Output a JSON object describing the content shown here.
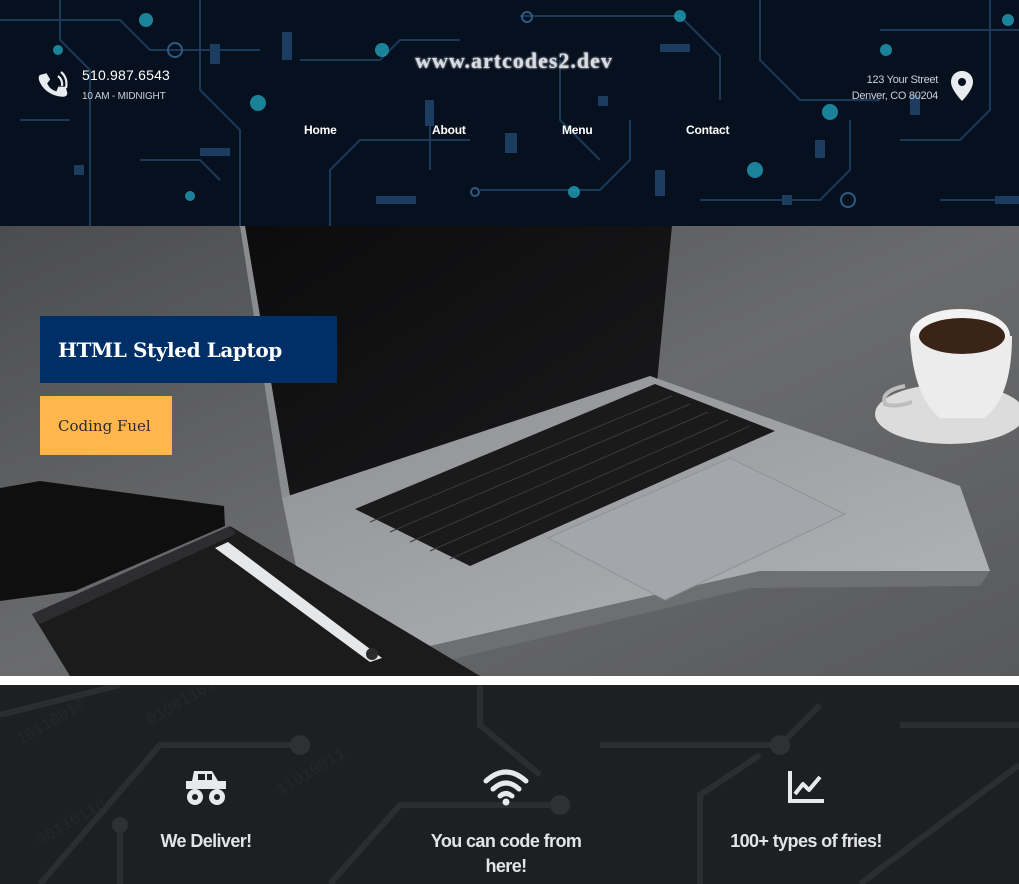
{
  "header": {
    "phone_number": "510.987.6543",
    "hours": "10 AM - MIDNIGHT",
    "logo_text": "www.artcodes2.dev",
    "address_line1": "123 Your Street",
    "address_line2": "Denver, CO 80204",
    "icons": {
      "phone": "phone-volume-icon",
      "location": "map-marker-icon"
    }
  },
  "nav": {
    "items": [
      {
        "label": "Home"
      },
      {
        "label": "About"
      },
      {
        "label": "Menu"
      },
      {
        "label": "Contact"
      }
    ]
  },
  "hero": {
    "title": "HTML Styled Laptop",
    "button_label": "Coding Fuel",
    "colors": {
      "title_bg": "#002e66",
      "button_bg": "#ffb74d"
    }
  },
  "features": {
    "items": [
      {
        "icon": "monster-truck-icon",
        "label": "We Deliver!"
      },
      {
        "icon": "wifi-icon",
        "label": "You can code from here!"
      },
      {
        "icon": "line-chart-icon",
        "label": "100+ types of fries!"
      }
    ]
  },
  "colors": {
    "header_bg": "#07101f",
    "circuit_accent": "#1fa0b8",
    "features_bg": "#1e1f21"
  }
}
